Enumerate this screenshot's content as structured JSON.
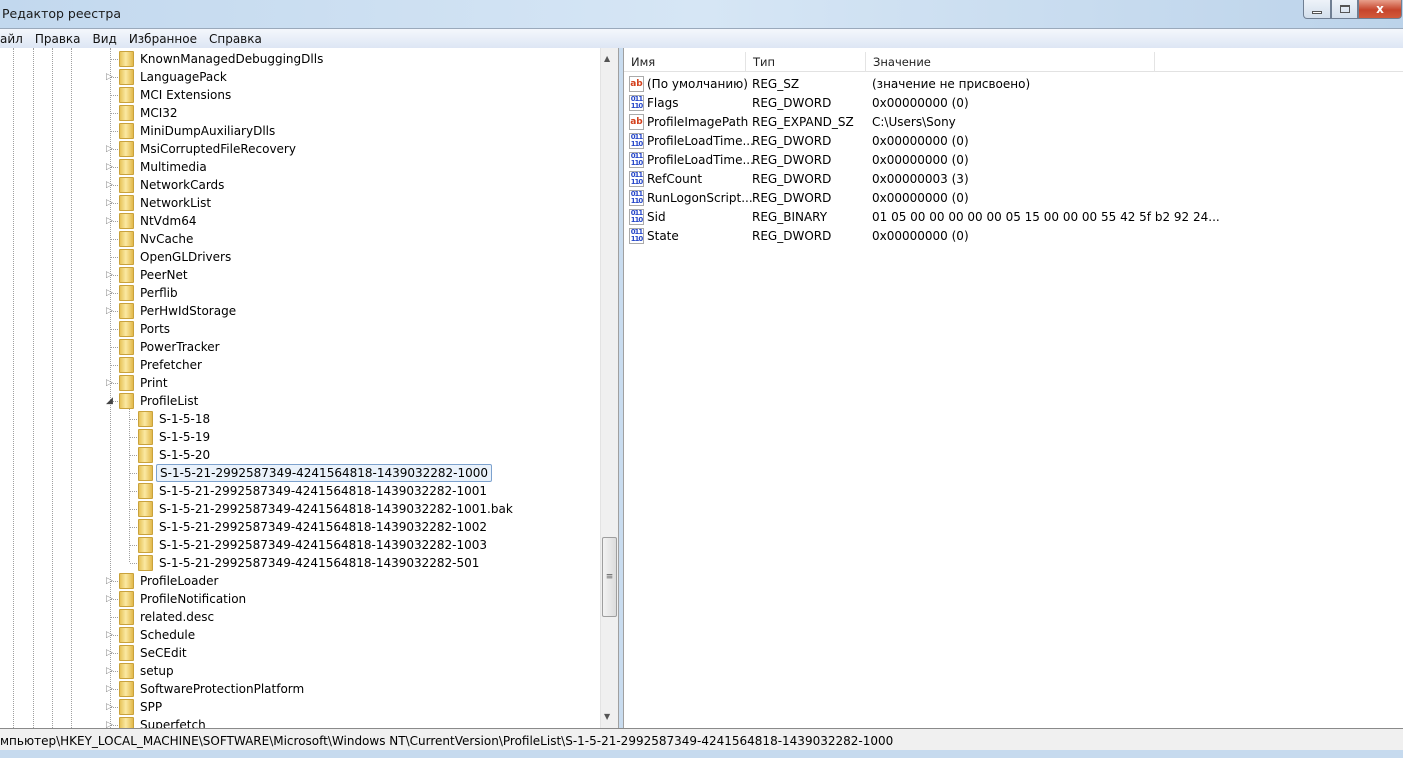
{
  "window": {
    "title": "Редактор реестра",
    "close_glyph": "x"
  },
  "menu": [
    "айл",
    "Правка",
    "Вид",
    "Избранное",
    "Справка"
  ],
  "tree": {
    "items": [
      {
        "label": "KnownManagedDebuggingDlls",
        "expandable": false,
        "level": 0
      },
      {
        "label": "LanguagePack",
        "expandable": true,
        "level": 0
      },
      {
        "label": "MCI Extensions",
        "expandable": false,
        "level": 0
      },
      {
        "label": "MCI32",
        "expandable": false,
        "level": 0
      },
      {
        "label": "MiniDumpAuxiliaryDlls",
        "expandable": false,
        "level": 0
      },
      {
        "label": "MsiCorruptedFileRecovery",
        "expandable": true,
        "level": 0
      },
      {
        "label": "Multimedia",
        "expandable": true,
        "level": 0
      },
      {
        "label": "NetworkCards",
        "expandable": true,
        "level": 0
      },
      {
        "label": "NetworkList",
        "expandable": true,
        "level": 0
      },
      {
        "label": "NtVdm64",
        "expandable": true,
        "level": 0
      },
      {
        "label": "NvCache",
        "expandable": false,
        "level": 0
      },
      {
        "label": "OpenGLDrivers",
        "expandable": false,
        "level": 0
      },
      {
        "label": "PeerNet",
        "expandable": true,
        "level": 0
      },
      {
        "label": "Perflib",
        "expandable": true,
        "level": 0
      },
      {
        "label": "PerHwIdStorage",
        "expandable": true,
        "level": 0
      },
      {
        "label": "Ports",
        "expandable": false,
        "level": 0
      },
      {
        "label": "PowerTracker",
        "expandable": false,
        "level": 0
      },
      {
        "label": "Prefetcher",
        "expandable": false,
        "level": 0
      },
      {
        "label": "Print",
        "expandable": true,
        "level": 0
      },
      {
        "label": "ProfileList",
        "expandable": true,
        "expanded": true,
        "level": 0
      },
      {
        "label": "S-1-5-18",
        "expandable": false,
        "level": 1
      },
      {
        "label": "S-1-5-19",
        "expandable": false,
        "level": 1
      },
      {
        "label": "S-1-5-20",
        "expandable": false,
        "level": 1
      },
      {
        "label": "S-1-5-21-2992587349-4241564818-1439032282-1000",
        "expandable": false,
        "level": 1,
        "selected": true
      },
      {
        "label": "S-1-5-21-2992587349-4241564818-1439032282-1001",
        "expandable": false,
        "level": 1
      },
      {
        "label": "S-1-5-21-2992587349-4241564818-1439032282-1001.bak",
        "expandable": false,
        "level": 1
      },
      {
        "label": "S-1-5-21-2992587349-4241564818-1439032282-1002",
        "expandable": false,
        "level": 1
      },
      {
        "label": "S-1-5-21-2992587349-4241564818-1439032282-1003",
        "expandable": false,
        "level": 1
      },
      {
        "label": "S-1-5-21-2992587349-4241564818-1439032282-501",
        "expandable": false,
        "level": 1
      },
      {
        "label": "ProfileLoader",
        "expandable": true,
        "level": 0
      },
      {
        "label": "ProfileNotification",
        "expandable": true,
        "level": 0
      },
      {
        "label": "related.desc",
        "expandable": false,
        "level": 0
      },
      {
        "label": "Schedule",
        "expandable": true,
        "level": 0
      },
      {
        "label": "SeCEdit",
        "expandable": true,
        "level": 0
      },
      {
        "label": "setup",
        "expandable": true,
        "level": 0
      },
      {
        "label": "SoftwareProtectionPlatform",
        "expandable": true,
        "level": 0
      },
      {
        "label": "SPP",
        "expandable": true,
        "level": 0
      },
      {
        "label": "Superfetch",
        "expandable": true,
        "level": 0
      }
    ]
  },
  "list": {
    "columns": [
      "Имя",
      "Тип",
      "Значение"
    ],
    "rows": [
      {
        "icon": "string-value-icon",
        "name": "(По умолчанию)",
        "type": "REG_SZ",
        "value": "(значение не присвоено)"
      },
      {
        "icon": "binary-value-icon",
        "name": "Flags",
        "type": "REG_DWORD",
        "value": "0x00000000 (0)"
      },
      {
        "icon": "string-value-icon",
        "name": "ProfileImagePath",
        "type": "REG_EXPAND_SZ",
        "value": "C:\\Users\\Sony"
      },
      {
        "icon": "binary-value-icon",
        "name": "ProfileLoadTime...",
        "type": "REG_DWORD",
        "value": "0x00000000 (0)"
      },
      {
        "icon": "binary-value-icon",
        "name": "ProfileLoadTime...",
        "type": "REG_DWORD",
        "value": "0x00000000 (0)"
      },
      {
        "icon": "binary-value-icon",
        "name": "RefCount",
        "type": "REG_DWORD",
        "value": "0x00000003 (3)"
      },
      {
        "icon": "binary-value-icon",
        "name": "RunLogonScript...",
        "type": "REG_DWORD",
        "value": "0x00000000 (0)"
      },
      {
        "icon": "binary-value-icon",
        "name": "Sid",
        "type": "REG_BINARY",
        "value": "01 05 00 00 00 00 00 05 15 00 00 00 55 42 5f b2 92 24..."
      },
      {
        "icon": "binary-value-icon",
        "name": "State",
        "type": "REG_DWORD",
        "value": "0x00000000 (0)"
      }
    ]
  },
  "status": {
    "path": "мпьютер\\HKEY_LOCAL_MACHINE\\SOFTWARE\\Microsoft\\Windows NT\\CurrentVersion\\ProfileList\\S-1-5-21-2992587349-4241564818-1439032282-1000"
  }
}
